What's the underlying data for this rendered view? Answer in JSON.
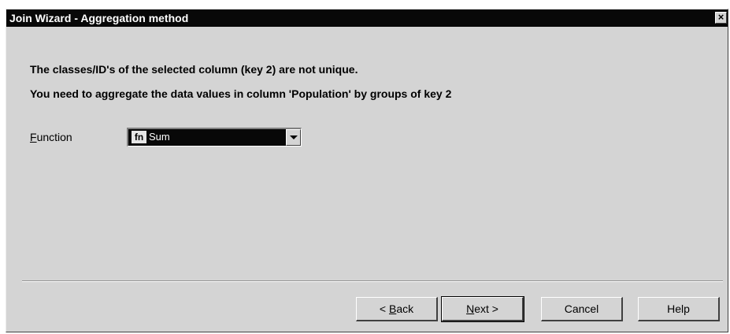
{
  "window": {
    "title": "Join Wizard - Aggregation method",
    "close_glyph": "×"
  },
  "messages": {
    "line1": "The classes/ID's of the selected column (key 2) are not unique.",
    "line2": "You need to aggregate the data values in column 'Population' by groups of key 2"
  },
  "function": {
    "label_mnemonic": "F",
    "label_rest": "unction",
    "icon_text": "fn",
    "icon": "function-icon",
    "selected_value": "Sum"
  },
  "buttons": {
    "back_prefix": "< ",
    "back_mnemonic": "B",
    "back_rest": "ack",
    "next_mnemonic": "N",
    "next_rest": "ext >",
    "cancel": "Cancel",
    "help": "Help"
  },
  "colors": {
    "dialog_bg": "#d4d4d4",
    "titlebar_bg": "#080808",
    "selection_bg": "#080808"
  }
}
